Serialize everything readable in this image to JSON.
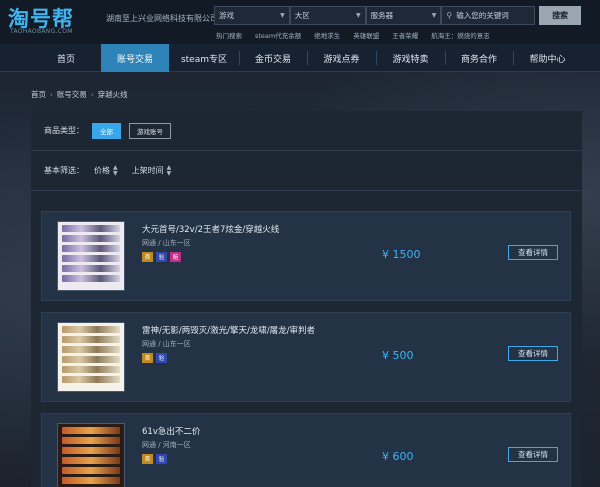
{
  "header": {
    "logo_text": "淘号帮",
    "logo_sub": "TAOHAOBANG.COM",
    "company": "湖南至上兴业网络科技有限公司",
    "selects": [
      {
        "id": "game",
        "value": "游戏"
      },
      {
        "id": "area",
        "value": "大区"
      },
      {
        "id": "server",
        "value": "服务器"
      }
    ],
    "search_placeholder": "输入您的关键词",
    "search_button": "搜索",
    "hot_links": [
      "热门搜索",
      "steam代充余额",
      "绝地求生",
      "英雄联盟",
      "王者荣耀",
      "航海王：燃烧的意志"
    ]
  },
  "nav": {
    "items": [
      {
        "label": "首页",
        "active": false
      },
      {
        "label": "账号交易",
        "active": true
      },
      {
        "label": "steam专区",
        "active": false
      },
      {
        "label": "金币交易",
        "active": false
      },
      {
        "label": "游戏点券",
        "active": false
      },
      {
        "label": "游戏特卖",
        "active": false
      },
      {
        "label": "商务合作",
        "active": false
      },
      {
        "label": "帮助中心",
        "active": false
      }
    ]
  },
  "breadcrumb": [
    "首页",
    "账号交易",
    "穿越火线"
  ],
  "filters": {
    "type_label": "商品类型：",
    "type_options": [
      {
        "label": "全部",
        "active": true
      },
      {
        "label": "游戏账号",
        "active": false
      }
    ],
    "basic_label": "基本筛选：",
    "sort_options": [
      "价格",
      "上架时间"
    ]
  },
  "listings": [
    {
      "title": "大元首号/32v/2王者7炫金/穿越火线",
      "region": "网通 / 山东一区",
      "badges": [
        {
          "text": "首",
          "color": "#c28a1c"
        },
        {
          "text": "验",
          "color": "#3048b0"
        },
        {
          "text": "赔",
          "color": "#c22f8a"
        }
      ],
      "price": "¥ 1500",
      "detail_label": "查看详情"
    },
    {
      "title": "雷神/无影/两毁灭/激光/擎天/龙啸/屠龙/审判者",
      "region": "网通 / 山东一区",
      "badges": [
        {
          "text": "首",
          "color": "#c28a1c"
        },
        {
          "text": "验",
          "color": "#3048b0"
        }
      ],
      "price": "¥ 500",
      "detail_label": "查看详情"
    },
    {
      "title": "61v急出不二价",
      "region": "网通 / 河南一区",
      "badges": [
        {
          "text": "首",
          "color": "#c28a1c"
        },
        {
          "text": "验",
          "color": "#3048b0"
        }
      ],
      "price": "¥ 600",
      "detail_label": "查看详情"
    }
  ],
  "colors": {
    "accent": "#37a6ea",
    "price": "#3cb3f2",
    "nav_active": "#2e84b8"
  }
}
